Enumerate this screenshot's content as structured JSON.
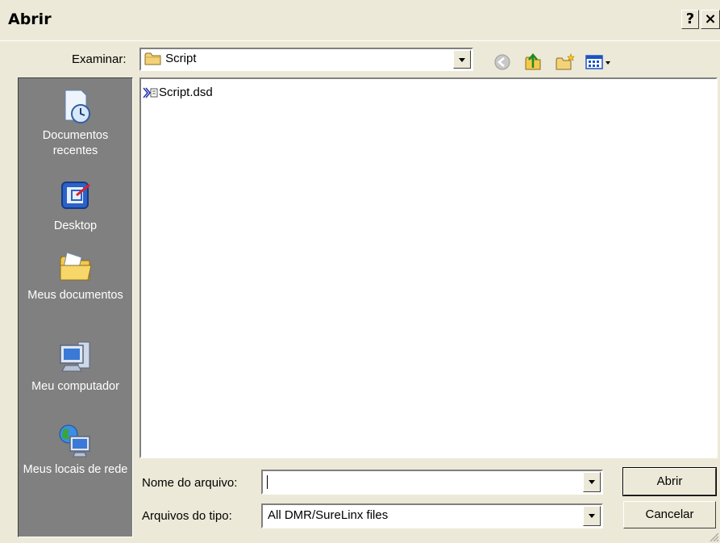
{
  "window": {
    "title": "Abrir",
    "help_label": "?",
    "close_label": "×"
  },
  "toolbar": {
    "look_in_label": "Examinar:",
    "look_in_value": "Script",
    "icons": [
      "back-icon",
      "up-folder-icon",
      "new-folder-icon",
      "views-menu-icon"
    ]
  },
  "places": [
    {
      "label": "Documentos recentes",
      "icon": "recent-documents-icon"
    },
    {
      "label": "Desktop",
      "icon": "desktop-icon"
    },
    {
      "label": "Meus documentos",
      "icon": "my-documents-icon"
    },
    {
      "label": "Meu computador",
      "icon": "my-computer-icon"
    },
    {
      "label": "Meus locais de rede",
      "icon": "network-places-icon"
    }
  ],
  "files": [
    {
      "name": "Script.dsd",
      "icon": "dsd-file-icon"
    }
  ],
  "filename": {
    "label": "Nome do arquivo:",
    "value": ""
  },
  "filetype": {
    "label": "Arquivos do tipo:",
    "value": "All DMR/SureLinx files"
  },
  "buttons": {
    "open": "Abrir",
    "cancel": "Cancelar"
  }
}
